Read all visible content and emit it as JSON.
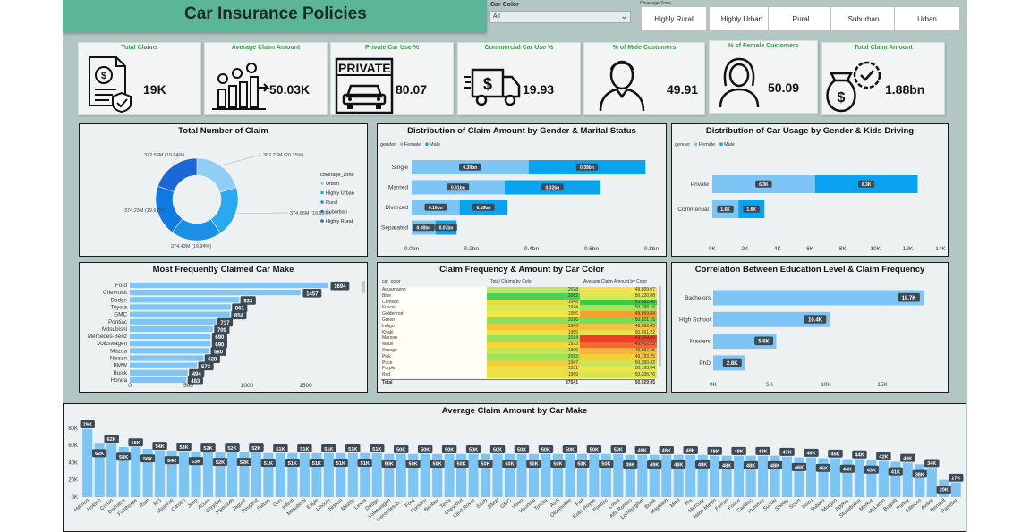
{
  "header": {
    "title": "Car Insurance Policies"
  },
  "slicers": {
    "car_color_label": "Car Color",
    "car_color_value": "All",
    "coverage_label": "Coverage Zone",
    "coverage_buttons": [
      "Highly Rural",
      "Highly Urban",
      "Rural",
      "Suburban",
      "Urban"
    ]
  },
  "kpis": [
    {
      "title": "Total Claims",
      "value": "19K",
      "icon": "claim-document-icon"
    },
    {
      "title": "Average Claim Amount",
      "value": "50.03K",
      "icon": "bar-growth-icon"
    },
    {
      "title": "Private Car Use %",
      "value": "80.07",
      "icon": "private-car-icon",
      "badge": "PRIVATE"
    },
    {
      "title": "Commercial Car Use %",
      "value": "19.93",
      "icon": "commercial-truck-icon"
    },
    {
      "title": "% of Male Customers",
      "value": "49.91",
      "icon": "male-user-icon"
    },
    {
      "title": "% of Female Customers",
      "value": "50.09",
      "icon": "female-user-icon"
    },
    {
      "title": "Total Claim Amount",
      "value": "1.88bn",
      "icon": "money-bag-check-icon"
    }
  ],
  "colors": {
    "dark_blue": "#1a73e8",
    "mid_blue": "#00a2ed",
    "light_blue": "#7cc5f5",
    "kpi_title": "#3a9a52",
    "canvas": "#b2c6c3"
  },
  "chart_data": [
    {
      "id": "donut",
      "type": "pie",
      "title": "Total Number of Claim",
      "legend_title": "coverage_zone",
      "legend_position": "right",
      "slices": [
        {
          "name": "Urban",
          "value": 382.23,
          "label": "382.23M (20.35%)",
          "color": "#90cdf7"
        },
        {
          "name": "Highly Urban",
          "value": 374.66,
          "label": "374.66M (19.95%)",
          "color": "#28a9f0"
        },
        {
          "name": "Rural",
          "value": 374.43,
          "label": "374.43M (19.94%)",
          "color": "#1c8fe5"
        },
        {
          "name": "Suburban",
          "value": 374.23,
          "label": "374.23M (19.93%)",
          "color": "#0e7be0"
        },
        {
          "name": "Highly Rural",
          "value": 372.59,
          "label": "372.59M (19.84%)",
          "color": "#1a67d6"
        }
      ]
    },
    {
      "id": "gender_marital",
      "type": "bar",
      "orientation": "horizontal-stacked",
      "title": "Distribution of Claim Amount by Gender & Marital Status",
      "legend_title": "gender",
      "legend_position": "top-left",
      "categories": [
        "Single",
        "Married",
        "Divorced",
        "Separated"
      ],
      "series": [
        {
          "name": "Female",
          "values": [
            0.39,
            0.31,
            0.16,
            0.08
          ],
          "labels": [
            "0.39bn",
            "0.31bn",
            "0.16bn",
            "0.08bn"
          ],
          "color": "#7cc5f5"
        },
        {
          "name": "Male",
          "values": [
            0.39,
            0.32,
            0.16,
            0.07
          ],
          "labels": [
            "0.39bn",
            "0.32bn",
            "0.16bn",
            "0.07bn"
          ],
          "color": "#0aa3ef"
        }
      ],
      "xticks": [
        "0.0bn",
        "0.2bn",
        "0.4bn",
        "0.6bn",
        "0.8bn"
      ],
      "xlim": [
        0,
        0.8
      ]
    },
    {
      "id": "usage_gender",
      "type": "bar",
      "orientation": "horizontal-stacked",
      "title": "Distribution of Car Usage by Gender & Kids Driving",
      "legend_title": "gender",
      "legend_position": "top-left",
      "categories": [
        "Private",
        "Commercial"
      ],
      "series": [
        {
          "name": "Female",
          "values": [
            6300,
            1600
          ],
          "labels": [
            "6.3K",
            "1.6K"
          ],
          "color": "#7cc5f5"
        },
        {
          "name": "Male",
          "values": [
            6300,
            1600
          ],
          "labels": [
            "6.3K",
            "1.6K"
          ],
          "color": "#0aa3ef"
        }
      ],
      "xticks": [
        "0K",
        "2K",
        "4K",
        "6K",
        "8K",
        "10K",
        "12K",
        "14K"
      ],
      "xlim": [
        0,
        14000
      ]
    },
    {
      "id": "car_make_freq",
      "type": "bar",
      "orientation": "horizontal",
      "title": "Most Frequently Claimed Car Make",
      "categories": [
        "Ford",
        "Chevrolet",
        "Dodge",
        "Toyota",
        "GMC",
        "Pontiac",
        "Mitsubishi",
        "Mercedes-Benz",
        "Volkswagen",
        "Mazda",
        "Nissan",
        "BMW",
        "Buick",
        "Honda"
      ],
      "values": [
        1694,
        1457,
        933,
        861,
        854,
        737,
        709,
        690,
        690,
        680,
        628,
        573,
        494,
        483
      ],
      "xticks": [
        "0",
        "500",
        "1000",
        "1500"
      ],
      "xlim": [
        0,
        1800
      ]
    },
    {
      "id": "car_color_table",
      "type": "table",
      "title": "Claim Frequency & Amount by Car Color",
      "columns": [
        "car_color",
        "Total Claims by Color",
        "Average Claim Amount by Color"
      ],
      "rows": [
        [
          "Aquamarine",
          "2028",
          "49,809.07"
        ],
        [
          "Blue",
          "2062",
          "50,220.88"
        ],
        [
          "Crimson",
          "1948",
          "51,582.40"
        ],
        [
          "Fuscia",
          "1974",
          "50,398.16"
        ],
        [
          "Goldenrod",
          "1956",
          "49,659.84"
        ],
        [
          "Green",
          "2016",
          "50,821.15"
        ],
        [
          "Indigo",
          "1943",
          "49,869.45"
        ],
        [
          "Khaki",
          "1965",
          "50,091.22"
        ],
        [
          "Maroon",
          "2014",
          "49,304.50"
        ],
        [
          "Mauv",
          "1973",
          "49,452.23"
        ],
        [
          "Orange",
          "1999",
          "49,587.45"
        ],
        [
          "Pink",
          "2013",
          "49,783.25"
        ],
        [
          "Puce",
          "1947",
          "50,300.32"
        ],
        [
          "Purple",
          "1951",
          "50,163.04"
        ],
        [
          "Red",
          "1969",
          "50,206.76"
        ]
      ],
      "row_colors": [
        [
          "#fffdf5",
          "#b6e86a",
          "#f6e04c"
        ],
        [
          "#fffdf5",
          "#4cd15a",
          "#d6ea52"
        ],
        [
          "#fffdf5",
          "#e8de42",
          "#3ec743"
        ],
        [
          "#fffdf5",
          "#d9e750",
          "#a6e451"
        ],
        [
          "#fffdf5",
          "#f2e648",
          "#f4a12e"
        ],
        [
          "#fffdf5",
          "#8bdf5d",
          "#7bdb55"
        ],
        [
          "#fffdf5",
          "#f8c436",
          "#f2c242"
        ],
        [
          "#fffdf5",
          "#e7e346",
          "#e6e64a"
        ],
        [
          "#fffdf5",
          "#97e15c",
          "#f23c2a"
        ],
        [
          "#fffdf5",
          "#f2d940",
          "#f26a33"
        ],
        [
          "#fffdf5",
          "#c6e552",
          "#f5b737"
        ],
        [
          "#fffdf5",
          "#a1e358",
          "#f6cd3d"
        ],
        [
          "#fffdf5",
          "#f4ce3c",
          "#c8e657"
        ],
        [
          "#fffdf5",
          "#f0de44",
          "#ebe54a"
        ],
        [
          "#fffdf5",
          "#e9e147",
          "#d9e451"
        ]
      ],
      "total_row": [
        "Total",
        "27541",
        "50,029.95"
      ]
    },
    {
      "id": "education",
      "type": "bar",
      "orientation": "horizontal",
      "title": "Correlation Between Education Level & Claim Frequency",
      "categories": [
        "Bachelors",
        "High School",
        "Masters",
        "PhD"
      ],
      "values": [
        18700,
        10400,
        5600,
        2800
      ],
      "labels": [
        "18.7K",
        "10.4K",
        "5.6K",
        "2.8K"
      ],
      "xticks": [
        "0K",
        "5K",
        "10K",
        "15K"
      ],
      "xlim": [
        0,
        20000
      ]
    },
    {
      "id": "avg_claim_by_make",
      "type": "bar",
      "orientation": "vertical",
      "title": "Average Claim Amount by Car Make",
      "categories": [
        "Hillman",
        "Holden",
        "Corbin",
        "Daihatsu",
        "Fairthorpe",
        "Ram",
        "MG",
        "Maserati",
        "Citroën",
        "Jeep",
        "Acura",
        "Chrysler",
        "Plymouth",
        "Jaguar",
        "Peugeot",
        "Saturn",
        "Geo",
        "Infiniti",
        "Mitsubishi",
        "Eagle",
        "Lincoln",
        "Nissan",
        "Mazda",
        "Lexus",
        "Dodge",
        "Volkswagen",
        "Mercedes-B...",
        "Ford",
        "Porsche",
        "Bentley",
        "Tesla",
        "Chevrolet",
        "Land Rover",
        "Saab",
        "BMW",
        "GMC",
        "Volvo",
        "Hyundai",
        "Toyota",
        "Audi",
        "Oldsmobile",
        "Fiat",
        "Rolls-Royce",
        "Pontiac",
        "Lotus",
        "Alfa Romeo",
        "Lamborghini",
        "Buick",
        "Maybach",
        "MINI",
        "Kia",
        "Mercury",
        "Aston Martin",
        "Ferrari",
        "Foose",
        "Cadillac",
        "Hummer",
        "Suzuki",
        "Shelby",
        "Scion",
        "Isuzu",
        "Subaru",
        "Morgan",
        "Spyker",
        "Studebaker",
        "Merkur",
        "McLaren",
        "Bugatti",
        "Panoz",
        "Fillmore",
        "Avanti",
        "Renault",
        "Rambler"
      ],
      "values": [
        79000,
        62000,
        62000,
        58000,
        58000,
        56000,
        54000,
        54000,
        53000,
        53000,
        52000,
        52000,
        52000,
        52000,
        52000,
        51000,
        51000,
        51000,
        51000,
        51000,
        51000,
        51000,
        51000,
        51000,
        51000,
        50000,
        50000,
        50000,
        50000,
        50000,
        50000,
        50000,
        50000,
        50000,
        50000,
        50000,
        50000,
        50000,
        50000,
        50000,
        50000,
        50000,
        50000,
        50000,
        50000,
        49000,
        49000,
        49000,
        49000,
        49000,
        49000,
        49000,
        48000,
        48000,
        48000,
        48000,
        48000,
        48000,
        47000,
        46000,
        46000,
        45000,
        45000,
        44000,
        44000,
        43000,
        42000,
        41000,
        40000,
        38000,
        34000,
        20000,
        17000
      ],
      "labels": [
        "79K",
        "62K",
        "62K",
        "58K",
        "58K",
        "56K",
        "54K",
        "54K",
        "53K",
        "53K",
        "52K",
        "52K",
        "52K",
        "52K",
        "52K",
        "51K",
        "51K",
        "51K",
        "51K",
        "51K",
        "51K",
        "51K",
        "51K",
        "51K",
        "51K",
        "50K",
        "50K",
        "50K",
        "50K",
        "50K",
        "50K",
        "50K",
        "50K",
        "50K",
        "50K",
        "50K",
        "50K",
        "50K",
        "50K",
        "50K",
        "50K",
        "50K",
        "50K",
        "50K",
        "50K",
        "49K",
        "49K",
        "49K",
        "49K",
        "49K",
        "49K",
        "49K",
        "48K",
        "48K",
        "48K",
        "48K",
        "48K",
        "48K",
        "47K",
        "46K",
        "46K",
        "45K",
        "45K",
        "44K",
        "44K",
        "43K",
        "42K",
        "41K",
        "40K",
        "38K",
        "34K",
        "20K",
        "17K"
      ],
      "yticks": [
        "0K",
        "20K",
        "40K",
        "60K",
        "80K"
      ],
      "ylim": [
        0,
        85000
      ]
    }
  ]
}
